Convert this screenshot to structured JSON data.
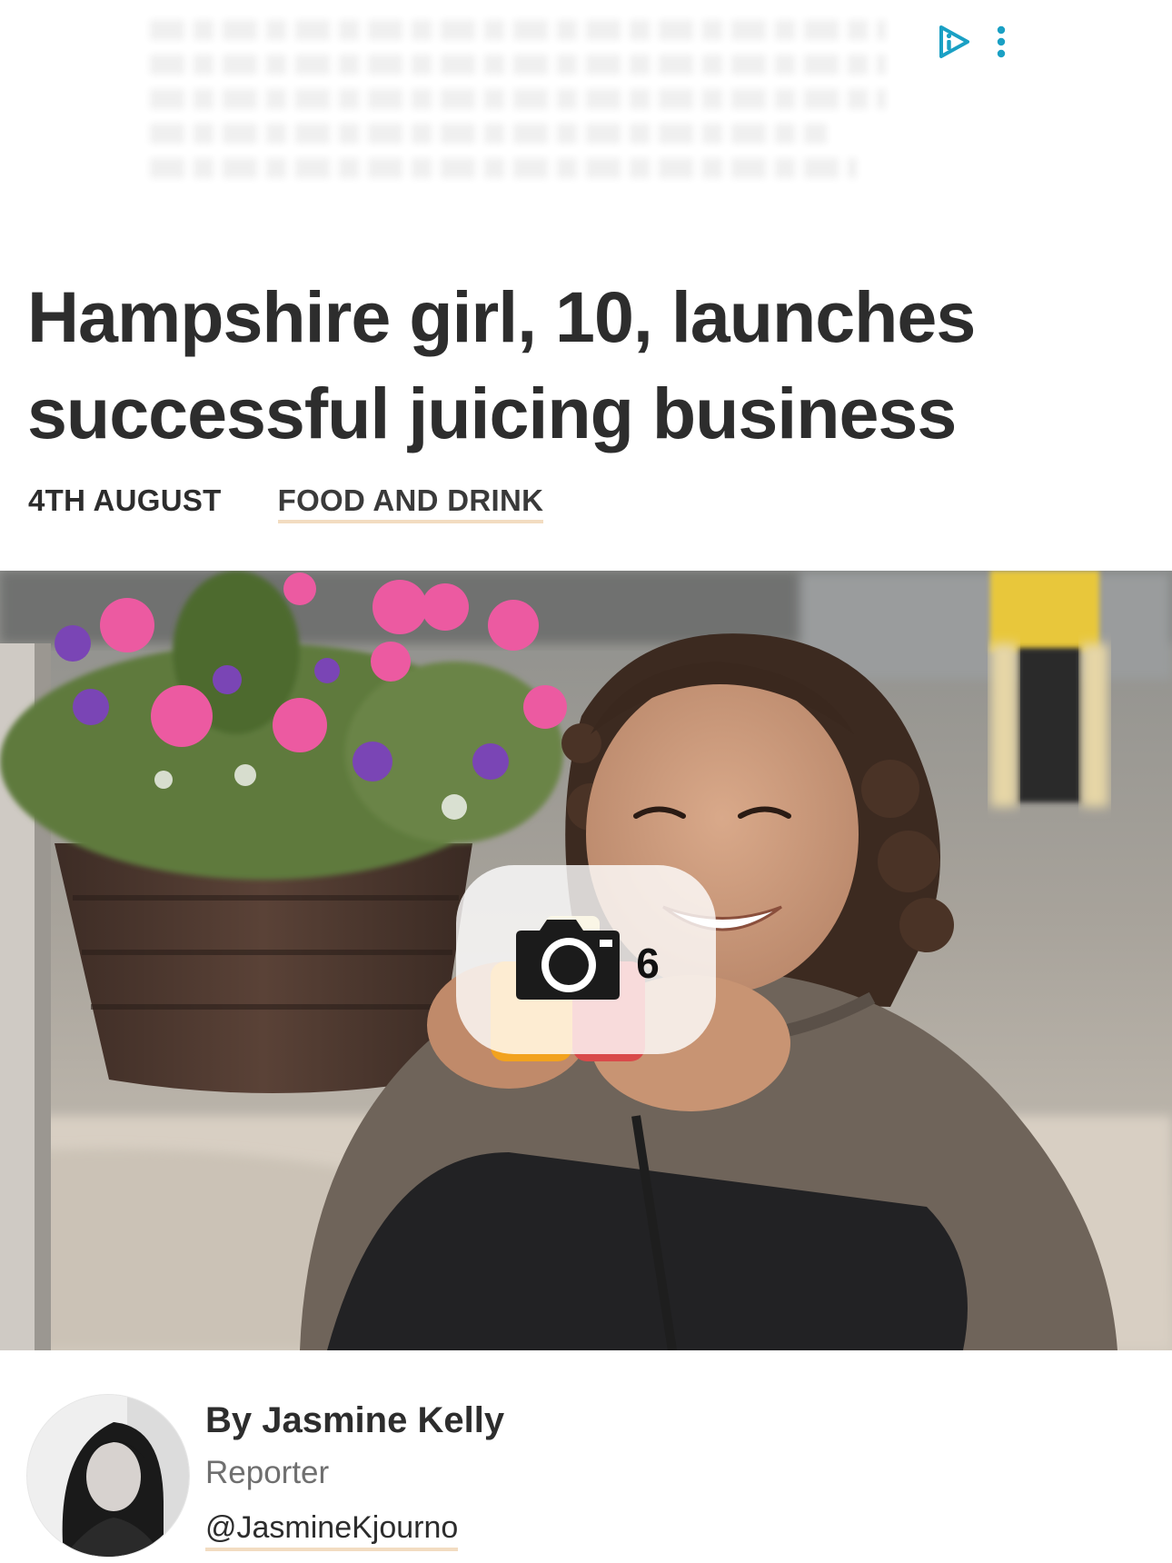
{
  "article": {
    "headline": "Hampshire girl, 10, launches successful juicing business",
    "date": "4TH AUGUST",
    "category": "FOOD AND DRINK"
  },
  "gallery": {
    "photo_count": "6",
    "icon": "camera-icon"
  },
  "author": {
    "name": "By Jasmine Kelly",
    "role": "Reporter",
    "handle": "@JasmineKjourno"
  },
  "ad": {
    "icons": [
      "adchoices-icon",
      "more-vertical-icon"
    ]
  },
  "colors": {
    "text": "#2d2d2d",
    "muted": "#6f6f6f",
    "underline_accent": "#f2dcc1",
    "adchoices": "#1aa0c4"
  }
}
